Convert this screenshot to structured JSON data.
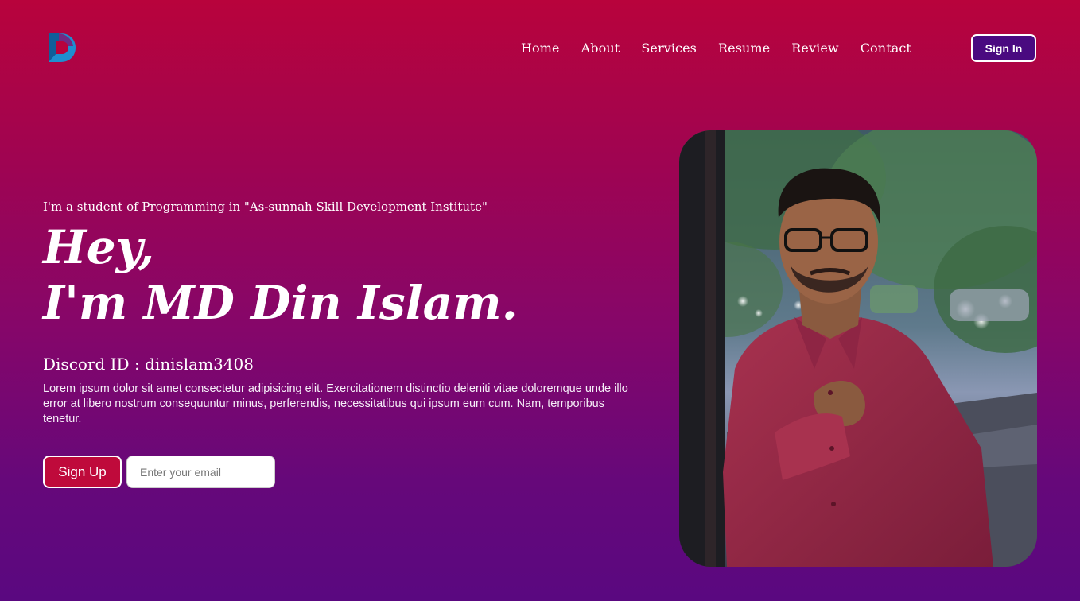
{
  "logo": {
    "icon": "logo-d-icon",
    "colors": {
      "primary": "#1e8fd0",
      "secondary": "#7a1f7a"
    }
  },
  "nav": {
    "items": [
      "Home",
      "About",
      "Services",
      "Resume",
      "Review",
      "Contact"
    ]
  },
  "header": {
    "signin_label": "Sign In"
  },
  "hero": {
    "kicker": "I'm a student of Programming in \"As-sunnah Skill Development Institute\"",
    "headline_line1": "Hey,",
    "headline_line2": "I'm MD Din Islam.",
    "discord": "Discord ID : dinislam3408",
    "description": "Lorem ipsum dolor sit amet consectetur adipisicing elit. Exercitationem distinctio deleniti vitae doloremque unde illo error at libero nostrum consequuntur minus, perferendis, necessitatibus qui ipsum eum cum. Nam, temporibus tenetur."
  },
  "signup": {
    "button_label": "Sign Up",
    "email_placeholder": "Enter your email"
  },
  "colors": {
    "bg_top": "#b8033c",
    "bg_bottom": "#5a0880",
    "signin_bg": "#4a0a80",
    "signup_bg": "#bf0a3b"
  }
}
